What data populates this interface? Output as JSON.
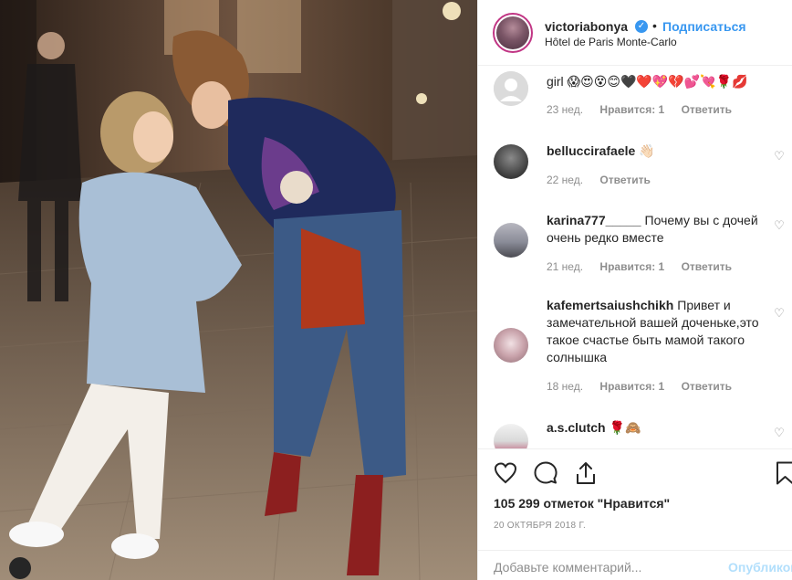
{
  "post": {
    "username": "victoriabonya",
    "verified_icon": "verified-badge-icon",
    "separator": "•",
    "follow_label": "Подписаться",
    "location": "Hôtel de Paris Monte-Carlo"
  },
  "comments": [
    {
      "user": "",
      "text": "girl 😱😍😵😊🖤❤️💖💔💕💘🌹💋",
      "age": "23 нед.",
      "likes": "Нравится: 1",
      "reply": "Ответить",
      "has_heart": false
    },
    {
      "user": "belluccirafaele",
      "text": "👋🏻",
      "age": "22 нед.",
      "likes": "",
      "reply": "Ответить",
      "has_heart": true
    },
    {
      "user": "karina777_____",
      "text": "Почему вы с дочей очень редко вместе",
      "age": "21 нед.",
      "likes": "Нравится: 1",
      "reply": "Ответить",
      "has_heart": true
    },
    {
      "user": "kafemertsaiushchikh",
      "text": "Привет и замечательной вашей доченьке,это такое счастье быть мамой такого солнышка",
      "age": "18 нед.",
      "likes": "Нравится: 1",
      "reply": "Ответить",
      "has_heart": true
    },
    {
      "user": "a.s.clutch",
      "text": "🌹🙈",
      "age": "",
      "likes": "",
      "reply": "",
      "has_heart": true
    }
  ],
  "actions": {
    "icons": [
      "heart-icon",
      "comment-icon",
      "share-icon",
      "bookmark-icon"
    ],
    "likes_text": "105 299 отметок \"Нравится\"",
    "date": "20 ОКТЯБРЯ 2018 Г.",
    "comment_placeholder": "Добавьте комментарий...",
    "publish_label": "Опубликовать"
  },
  "colors": {
    "accent": "#3897f0",
    "text": "#262626",
    "muted": "#8e8e8e",
    "border": "#efefef",
    "publish_disabled": "#b2dffc"
  }
}
